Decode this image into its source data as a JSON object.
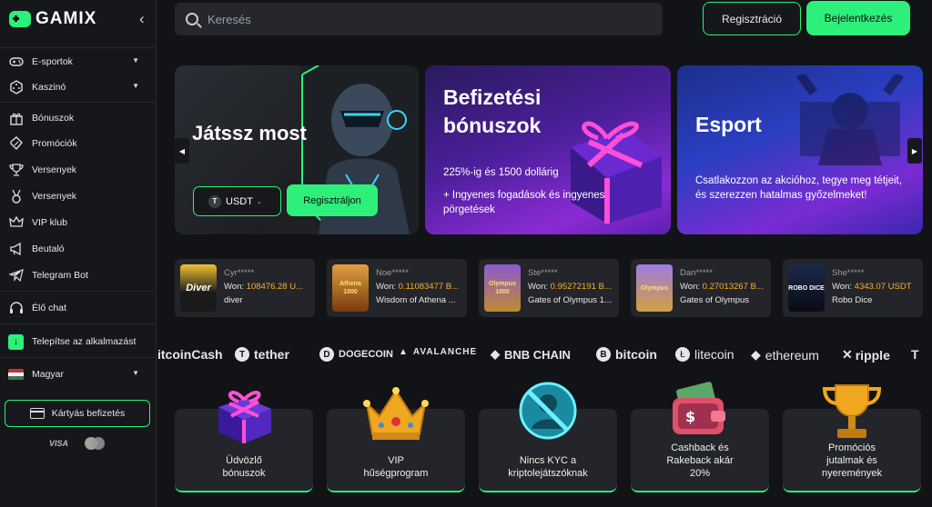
{
  "brand": {
    "name": "GAMIX",
    "accent": "#2cf07a"
  },
  "sidebar": {
    "collapse_icon": "chevron-left-icon",
    "items": [
      {
        "label": "E-sportok",
        "icon": "gamepad-icon",
        "has_submenu": true
      },
      {
        "label": "Kaszinó",
        "icon": "dice-icon",
        "has_submenu": true
      },
      {
        "label": "Bónuszok",
        "icon": "gift-icon",
        "has_submenu": false
      },
      {
        "label": "Promóciók",
        "icon": "ticket-icon",
        "has_submenu": false
      },
      {
        "label": "Versenyek",
        "icon": "trophy-icon",
        "has_submenu": false
      },
      {
        "label": "Versenyek",
        "icon": "medal-icon",
        "has_submenu": false
      },
      {
        "label": "VIP klub",
        "icon": "crown-icon",
        "has_submenu": false
      },
      {
        "label": "Beutaló",
        "icon": "megaphone-icon",
        "has_submenu": false
      },
      {
        "label": "Telegram Bot",
        "icon": "telegram-icon",
        "has_submenu": false
      }
    ],
    "live_chat": "Élő chat",
    "install_app": "Telepítse az alkalmazást",
    "language": "Magyar",
    "card_deposit": "Kártyás befizetés",
    "payment_logos": [
      "VISA",
      "mastercard"
    ]
  },
  "header": {
    "search_placeholder": "Keresés",
    "register_label": "Regisztráció",
    "login_label": "Bejelentkezés"
  },
  "banners": {
    "play": {
      "title": "Játssz most",
      "currency": "USDT",
      "cta": "Regisztráljon"
    },
    "deposit": {
      "title_line1": "Befizetési",
      "title_line2": "bónuszok",
      "line1": "225%-ig és 1500 dollárig",
      "line2": "+ Ingyenes fogadások és ingyenes pörgetések"
    },
    "esport": {
      "title": "Esport",
      "text": "Csatlakozzon az akcióhoz, tegye meg tétjeit, és szerezzen hatalmas győzelmeket!"
    }
  },
  "recent_wins": [
    {
      "user": "Cyr*****",
      "won_label": "Won:",
      "amount": "108476.28 U...",
      "game": "diver",
      "thumb": "Diver"
    },
    {
      "user": "Noe*****",
      "won_label": "Won:",
      "amount": "0.11083477 B...",
      "game": "Wisdom of Athena ...",
      "thumb": "Athena 1000"
    },
    {
      "user": "Ste*****",
      "won_label": "Won:",
      "amount": "0.95272191 B...",
      "game": "Gates of Olympus 1...",
      "thumb": "Olympus 1000"
    },
    {
      "user": "Dan*****",
      "won_label": "Won:",
      "amount": "0.27013267 B...",
      "game": "Gates of Olympus",
      "thumb": "Olympus"
    },
    {
      "user": "She*****",
      "won_label": "Won:",
      "amount": "4343.07 USDT",
      "game": "Robo Dice",
      "thumb": "ROBO DICE"
    }
  ],
  "crypto_logos": [
    {
      "label": "itcoinCash",
      "icon": ""
    },
    {
      "label": "tether",
      "icon": "T"
    },
    {
      "label": "DOGECOIN",
      "icon": "D"
    },
    {
      "label": "AVALANCHE",
      "icon": "▲"
    },
    {
      "label": "BNB CHAIN",
      "icon": "◆"
    },
    {
      "label": "bitcoin",
      "icon": "B"
    },
    {
      "label": "litecoin",
      "icon": "Ł"
    },
    {
      "label": "ethereum",
      "icon": "◆"
    },
    {
      "label": "ripple",
      "icon": "✕"
    },
    {
      "label": "",
      "icon": "T"
    }
  ],
  "features": [
    {
      "l1": "Üdvözlő",
      "l2": "bónuszok",
      "l3": "",
      "icon": "gift-box-icon"
    },
    {
      "l1": "VIP",
      "l2": "hűségprogram",
      "l3": "",
      "icon": "crown-icon"
    },
    {
      "l1": "Nincs KYC a",
      "l2": "kriptolejátszóknak",
      "l3": "",
      "icon": "no-kyc-icon"
    },
    {
      "l1": "Cashback és",
      "l2": "Rakeback akár",
      "l3": "20%",
      "icon": "wallet-icon"
    },
    {
      "l1": "Promóciós",
      "l2": "jutalmak és",
      "l3": "nyeremények",
      "icon": "trophy-icon"
    }
  ]
}
